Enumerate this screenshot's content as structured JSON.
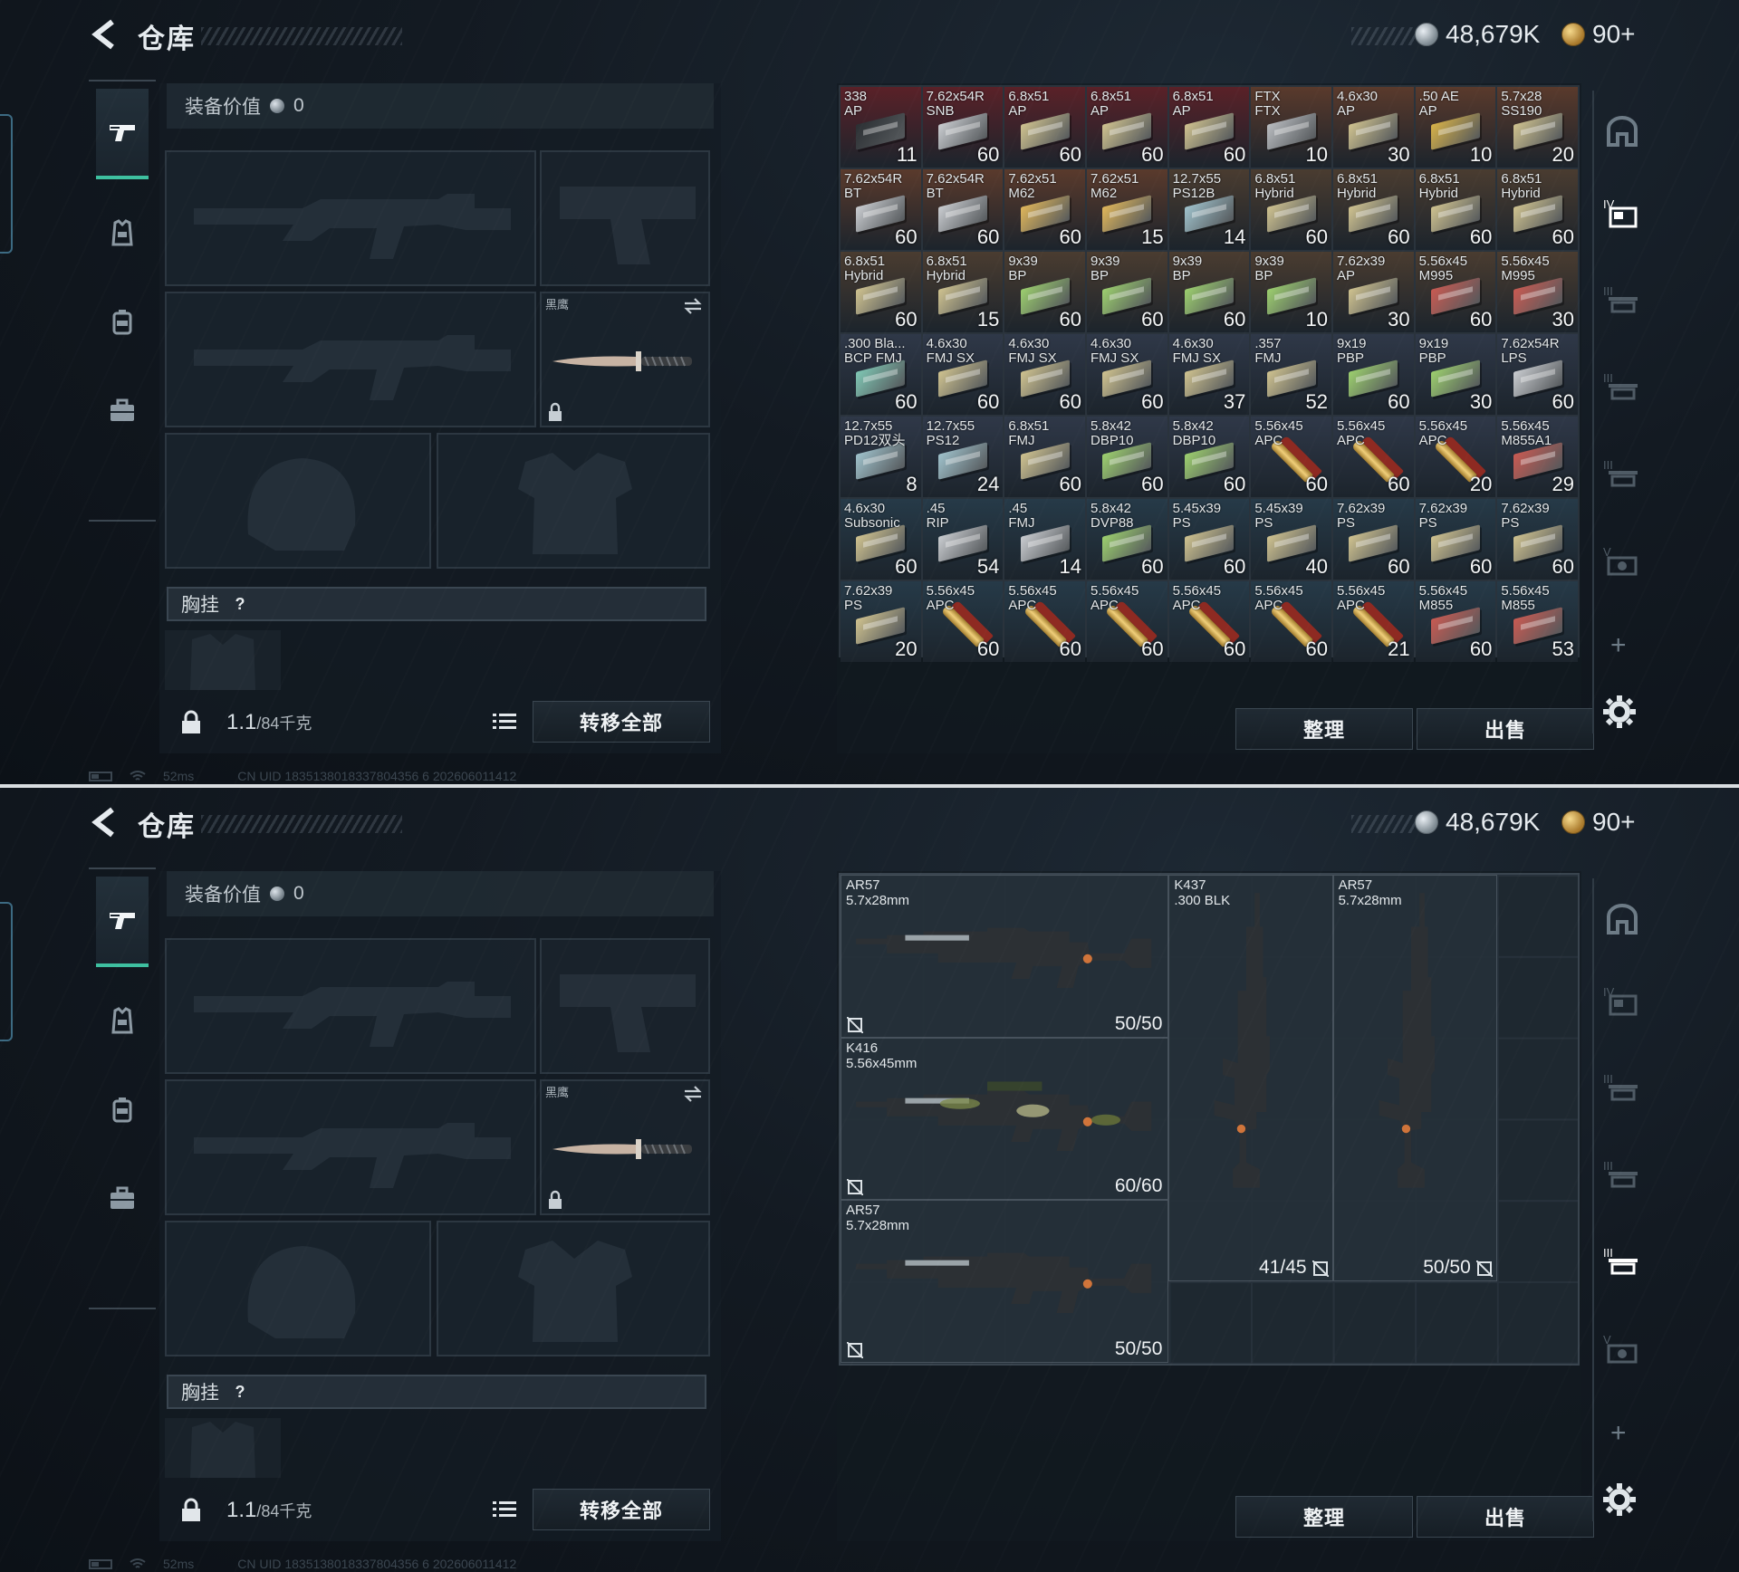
{
  "header": {
    "title": "仓库",
    "silver_amount": "48,679K",
    "gold_amount": "90+"
  },
  "loadout": {
    "equip_value_label": "装备价值",
    "equip_value": "0",
    "knife_label": "黑鹰",
    "chest_rig_label": "胸挂",
    "chest_rig_help": "?",
    "weight_current": "1.1",
    "weight_max": "/84千克",
    "transfer_all": "转移全部"
  },
  "actions": {
    "organize": "整理",
    "sell": "出售"
  },
  "status_bar": {
    "ping": "52ms",
    "uid": "CN UID 1835138018337804356 6 202606011412"
  },
  "right_rail": {
    "tab_labels": [
      "",
      "IV",
      "III",
      "III",
      "III",
      "V"
    ]
  },
  "ammo": [
    {
      "name": "338\nAP",
      "qty": "11",
      "color": "#2b2f33",
      "bg": "#5a2128"
    },
    {
      "name": "7.62x54R\nSNB",
      "qty": "60",
      "color": "#c9ccd0",
      "bg": "#5a2128"
    },
    {
      "name": "6.8x51\nAP",
      "qty": "60",
      "color": "#cfc28f",
      "bg": "#5a2128"
    },
    {
      "name": "6.8x51\nAP",
      "qty": "60",
      "color": "#cfc28f",
      "bg": "#5a2128"
    },
    {
      "name": "6.8x51\nAP",
      "qty": "60",
      "color": "#cfc28f",
      "bg": "#5a2128"
    },
    {
      "name": "FTX\nFTX",
      "qty": "10",
      "color": "#b9bcc0",
      "bg": "#5a3a2c"
    },
    {
      "name": "4.6x30\nAP",
      "qty": "30",
      "color": "#cfc28f",
      "bg": "#5a3a2c"
    },
    {
      "name": ".50 AE\nAP",
      "qty": "10",
      "color": "#d8b248",
      "bg": "#5a3a2c"
    },
    {
      "name": "5.7x28\nSS190",
      "qty": "20",
      "color": "#cfc28f",
      "bg": "#5a3a2c"
    },
    {
      "name": "7.62x54R\nBT",
      "qty": "60",
      "color": "#c9ccd0",
      "bg": "#5a3a2c"
    },
    {
      "name": "7.62x54R\nBT",
      "qty": "60",
      "color": "#c9ccd0",
      "bg": "#5a3a2c"
    },
    {
      "name": "7.62x51\nM62",
      "qty": "60",
      "color": "#e0b65a",
      "bg": "#5a3a2c"
    },
    {
      "name": "7.62x51\nM62",
      "qty": "15",
      "color": "#e0b65a",
      "bg": "#5a3a2c"
    },
    {
      "name": "12.7x55\nPS12B",
      "qty": "14",
      "color": "#9fc2cc",
      "bg": "#4a3c30"
    },
    {
      "name": "6.8x51\nHybrid",
      "qty": "60",
      "color": "#cfc28f",
      "bg": "#4a3c30"
    },
    {
      "name": "6.8x51\nHybrid",
      "qty": "60",
      "color": "#cfc28f",
      "bg": "#4a3c30"
    },
    {
      "name": "6.8x51\nHybrid",
      "qty": "60",
      "color": "#cfc28f",
      "bg": "#4a3c30"
    },
    {
      "name": "6.8x51\nHybrid",
      "qty": "60",
      "color": "#cfc28f",
      "bg": "#4a3c30"
    },
    {
      "name": "6.8x51\nHybrid",
      "qty": "60",
      "color": "#cfc28f",
      "bg": "#4a3c30"
    },
    {
      "name": "6.8x51\nHybrid",
      "qty": "15",
      "color": "#cfc28f",
      "bg": "#4a3c30"
    },
    {
      "name": "9x39\nBP",
      "qty": "60",
      "color": "#9ccf6e",
      "bg": "#4a3c30"
    },
    {
      "name": "9x39\nBP",
      "qty": "60",
      "color": "#9ccf6e",
      "bg": "#4a3c30"
    },
    {
      "name": "9x39\nBP",
      "qty": "60",
      "color": "#9ccf6e",
      "bg": "#4a3c30"
    },
    {
      "name": "9x39\nBP",
      "qty": "10",
      "color": "#9ccf6e",
      "bg": "#4a3c30"
    },
    {
      "name": "7.62x39\nAP",
      "qty": "30",
      "color": "#cfc28f",
      "bg": "#4a3c30"
    },
    {
      "name": "5.56x45\nM995",
      "qty": "60",
      "color": "#c95a52",
      "bg": "#4a3c30"
    },
    {
      "name": "5.56x45\nM995",
      "qty": "30",
      "color": "#c95a52",
      "bg": "#4a3c30"
    },
    {
      "name": ".300 Bla...\nBCP FMJ",
      "qty": "60",
      "color": "#7fc7b4",
      "bg": "#2f3848"
    },
    {
      "name": "4.6x30\nFMJ SX",
      "qty": "60",
      "color": "#cfc28f",
      "bg": "#2f3848"
    },
    {
      "name": "4.6x30\nFMJ SX",
      "qty": "60",
      "color": "#cfc28f",
      "bg": "#2f3848"
    },
    {
      "name": "4.6x30\nFMJ SX",
      "qty": "60",
      "color": "#cfc28f",
      "bg": "#2f3848"
    },
    {
      "name": "4.6x30\nFMJ SX",
      "qty": "37",
      "color": "#cfc28f",
      "bg": "#2f3848"
    },
    {
      "name": ".357\nFMJ",
      "qty": "52",
      "color": "#cfc28f",
      "bg": "#2f3848"
    },
    {
      "name": "9x19\nPBP",
      "qty": "60",
      "color": "#9ccf6e",
      "bg": "#2f3848"
    },
    {
      "name": "9x19\nPBP",
      "qty": "30",
      "color": "#9ccf6e",
      "bg": "#2f3848"
    },
    {
      "name": "7.62x54R\nLPS",
      "qty": "60",
      "color": "#c9ccd0",
      "bg": "#2f3848"
    },
    {
      "name": "12.7x55\nPD12双头",
      "qty": "8",
      "color": "#9fc2cc",
      "bg": "#2f3848"
    },
    {
      "name": "12.7x55\nPS12",
      "qty": "24",
      "color": "#9fc2cc",
      "bg": "#2f3848"
    },
    {
      "name": "6.8x51\nFMJ",
      "qty": "60",
      "color": "#cfc28f",
      "bg": "#2f3848"
    },
    {
      "name": "5.8x42\nDBP10",
      "qty": "60",
      "color": "#9ccf6e",
      "bg": "#2f3848"
    },
    {
      "name": "5.8x42\nDBP10",
      "qty": "60",
      "color": "#9ccf6e",
      "bg": "#2f3848"
    },
    {
      "name": "5.56x45\nAPC",
      "qty": "60",
      "color": "shells",
      "bg": "#2f3848"
    },
    {
      "name": "5.56x45\nAPC",
      "qty": "60",
      "color": "shells",
      "bg": "#2f3848"
    },
    {
      "name": "5.56x45\nAPC",
      "qty": "20",
      "color": "shells",
      "bg": "#2f3848"
    },
    {
      "name": "5.56x45\nM855A1",
      "qty": "29",
      "color": "#c95a52",
      "bg": "#2f3848"
    },
    {
      "name": "4.6x30\nSubsonic",
      "qty": "60",
      "color": "#cfc28f",
      "bg": "#263a48"
    },
    {
      "name": ".45\nRIP",
      "qty": "54",
      "color": "#c9ccd0",
      "bg": "#263a48"
    },
    {
      "name": ".45\nFMJ",
      "qty": "14",
      "color": "#c9ccd0",
      "bg": "#263a48"
    },
    {
      "name": "5.8x42\nDVP88",
      "qty": "60",
      "color": "#9ccf6e",
      "bg": "#263a48"
    },
    {
      "name": "5.45x39\nPS",
      "qty": "60",
      "color": "#cfc28f",
      "bg": "#263a48"
    },
    {
      "name": "5.45x39\nPS",
      "qty": "40",
      "color": "#cfc28f",
      "bg": "#263a48"
    },
    {
      "name": "7.62x39\nPS",
      "qty": "60",
      "color": "#cfc28f",
      "bg": "#263a48"
    },
    {
      "name": "7.62x39\nPS",
      "qty": "60",
      "color": "#cfc28f",
      "bg": "#263a48"
    },
    {
      "name": "7.62x39\nPS",
      "qty": "60",
      "color": "#cfc28f",
      "bg": "#263a48"
    },
    {
      "name": "7.62x39\nPS",
      "qty": "20",
      "color": "#cfc28f",
      "bg": "#263a48"
    },
    {
      "name": "5.56x45\nAPC",
      "qty": "60",
      "color": "shells",
      "bg": "#263a48"
    },
    {
      "name": "5.56x45\nAPC",
      "qty": "60",
      "color": "shells",
      "bg": "#263a48"
    },
    {
      "name": "5.56x45\nAPC",
      "qty": "60",
      "color": "shells",
      "bg": "#263a48"
    },
    {
      "name": "5.56x45\nAPC",
      "qty": "60",
      "color": "shells",
      "bg": "#263a48"
    },
    {
      "name": "5.56x45\nAPC",
      "qty": "60",
      "color": "shells",
      "bg": "#263a48"
    },
    {
      "name": "5.56x45\nAPC",
      "qty": "21",
      "color": "shells",
      "bg": "#263a48"
    },
    {
      "name": "5.56x45\nM855",
      "qty": "60",
      "color": "#c95a52",
      "bg": "#263a48"
    },
    {
      "name": "5.56x45\nM855",
      "qty": "53",
      "color": "#c95a52",
      "bg": "#263a48"
    }
  ],
  "weapons": [
    {
      "name": "AR57\n5.7x28mm",
      "ammo": "50/50",
      "orient": "h",
      "camo": false
    },
    {
      "name": "K416\n5.56x45mm",
      "ammo": "60/60",
      "orient": "h",
      "camo": true
    },
    {
      "name": "AR57\n5.7x28mm",
      "ammo": "50/50",
      "orient": "h",
      "camo": false
    },
    {
      "name": "K437\n.300 BLK",
      "ammo": "41/45",
      "orient": "v",
      "camo": false
    },
    {
      "name": "AR57\n5.7x28mm",
      "ammo": "50/50",
      "orient": "v",
      "camo": false
    }
  ]
}
